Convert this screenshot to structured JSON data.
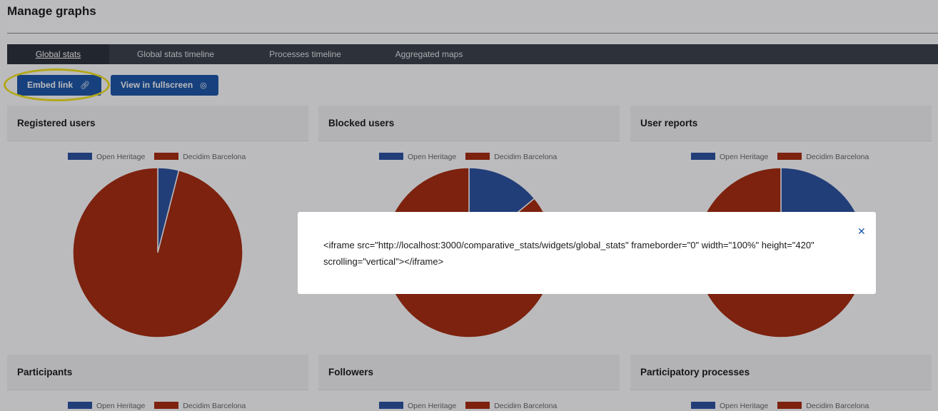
{
  "page": {
    "title": "Manage graphs"
  },
  "tabs": [
    {
      "label": "Global stats",
      "active": true
    },
    {
      "label": "Global stats timeline"
    },
    {
      "label": "Processes timeline"
    },
    {
      "label": "Aggregated maps"
    }
  ],
  "toolbar": {
    "embed_label": "Embed link",
    "embed_icon": "link-icon",
    "fullscreen_label": "View in fullscreen",
    "fullscreen_icon": "eye-icon"
  },
  "legend": {
    "series_a": "Open Heritage",
    "series_b": "Decidim Barcelona"
  },
  "colors": {
    "series_a": "#2c52a0",
    "series_b": "#a82b0c",
    "accent": "#1d57a7",
    "highlight": "#f3e31a"
  },
  "cards": [
    {
      "title": "Registered users"
    },
    {
      "title": "Blocked users"
    },
    {
      "title": "User reports"
    },
    {
      "title": "Participants"
    },
    {
      "title": "Followers"
    },
    {
      "title": "Participatory processes"
    }
  ],
  "chart_data": [
    {
      "type": "pie",
      "categories": [
        "Open Heritage",
        "Decidim Barcelona"
      ],
      "values": [
        4,
        96
      ]
    },
    {
      "type": "pie",
      "categories": [
        "Open Heritage",
        "Decidim Barcelona"
      ],
      "values": [
        14,
        86
      ]
    },
    {
      "type": "pie",
      "categories": [
        "Open Heritage",
        "Decidim Barcelona"
      ],
      "values": [
        18,
        82
      ]
    }
  ],
  "modal": {
    "code": "<iframe src=\"http://localhost:3000/comparative_stats/widgets/global_stats\" frameborder=\"0\" width=\"100%\" height=\"420\" scrolling=\"vertical\"></iframe>",
    "close_icon": "close-icon"
  }
}
